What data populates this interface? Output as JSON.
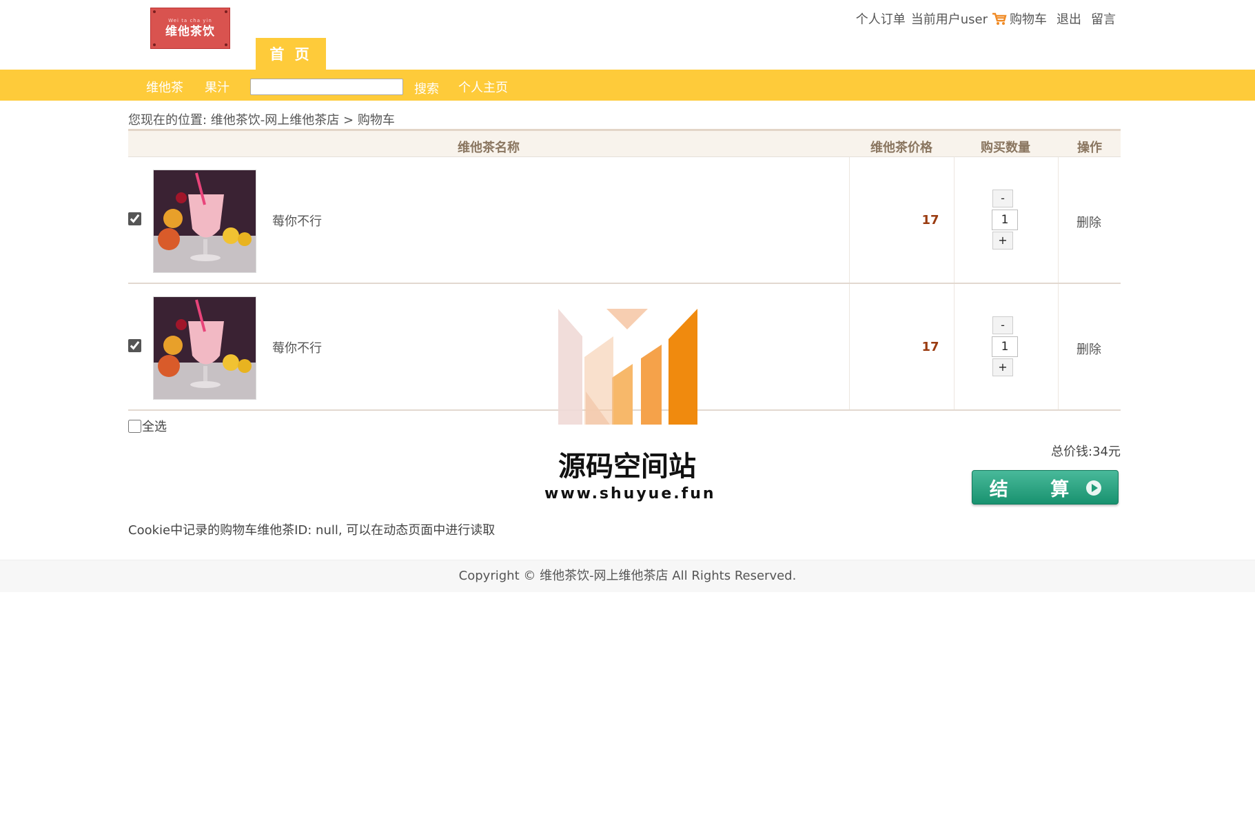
{
  "header": {
    "logo_text": "维他茶饮",
    "logo_sub": "Wei ta cha yin",
    "home_tab": "首 页",
    "links": {
      "orders": "个人订单",
      "current_user": "当前用户user",
      "cart": "购物车",
      "logout": "退出",
      "message": "留言"
    }
  },
  "nav": {
    "items": [
      "维他茶",
      "果汁"
    ],
    "search_value": "",
    "search_label": "搜索",
    "profile": "个人主页"
  },
  "breadcrumb": {
    "prefix": "您现在的位置: ",
    "home": "维他茶饮-网上维他茶店",
    "separator": " > ",
    "current": "购物车"
  },
  "table": {
    "headers": {
      "name": "维他茶名称",
      "price": "维他茶价格",
      "quantity": "购买数量",
      "action": "操作"
    },
    "rows": [
      {
        "name": "莓你不行",
        "price": "17",
        "quantity": "1",
        "checked": true,
        "delete": "删除",
        "minus": "-",
        "plus": "+"
      },
      {
        "name": "莓你不行",
        "price": "17",
        "quantity": "1",
        "checked": true,
        "delete": "删除",
        "minus": "-",
        "plus": "+"
      }
    ]
  },
  "select_all": "全选",
  "total": "总价钱:34元",
  "checkout": "结 算",
  "cookie_note": "Cookie中记录的购物车维他茶ID: null, 可以在动态页面中进行读取",
  "footer": "Copyright © 维他茶饮-网上维他茶店 All Rights Reserved.",
  "watermark": {
    "title": "源码空间站",
    "url": "www.shuyue.fun"
  },
  "colors": {
    "accent": "#fecb3a",
    "checkout": "#1e9b77",
    "price": "#9a3b10"
  }
}
